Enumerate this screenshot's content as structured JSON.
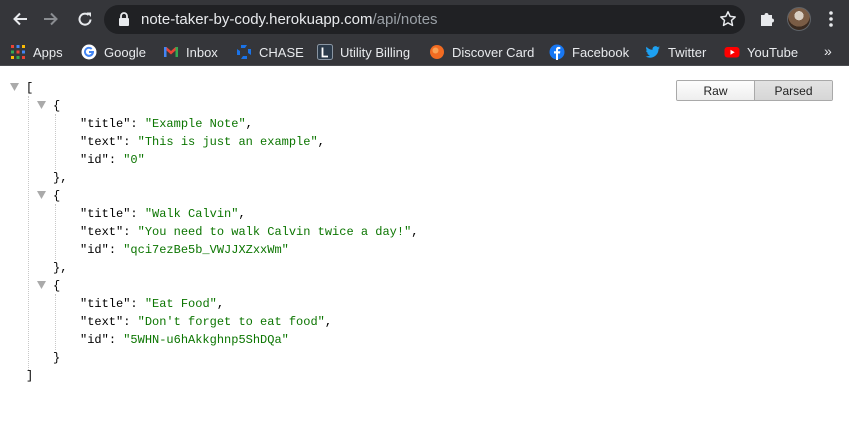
{
  "browser": {
    "url_host": "note-taker-by-cody.herokuapp.com",
    "url_path": "/api/notes"
  },
  "bookmarks": [
    {
      "label": "Apps",
      "icon": "apps-grid-icon"
    },
    {
      "label": "Google",
      "icon": "google-icon"
    },
    {
      "label": "Inbox",
      "icon": "gmail-icon"
    },
    {
      "label": "CHASE",
      "icon": "chase-icon"
    },
    {
      "label": "Utility Billing",
      "icon": "utility-billing-icon"
    },
    {
      "label": "Discover Card",
      "icon": "discover-icon"
    },
    {
      "label": "Facebook",
      "icon": "facebook-icon"
    },
    {
      "label": "Twitter",
      "icon": "twitter-icon"
    },
    {
      "label": "YouTube",
      "icon": "youtube-icon"
    }
  ],
  "bookmarks_overflow": "»",
  "viewer": {
    "raw_label": "Raw",
    "parsed_label": "Parsed",
    "open_bracket": "[",
    "close_bracket": "]",
    "notes": [
      {
        "title": "Example Note",
        "text": "This is just an example",
        "id": "0"
      },
      {
        "title": "Walk Calvin",
        "text": "You need to walk Calvin twice a day!",
        "id": "qci7ezBe5b_VWJJXZxxWm"
      },
      {
        "title": "Eat Food",
        "text": "Don't forget to eat food",
        "id": "5WHN-u6hAkkghnp5ShDQa"
      }
    ]
  }
}
